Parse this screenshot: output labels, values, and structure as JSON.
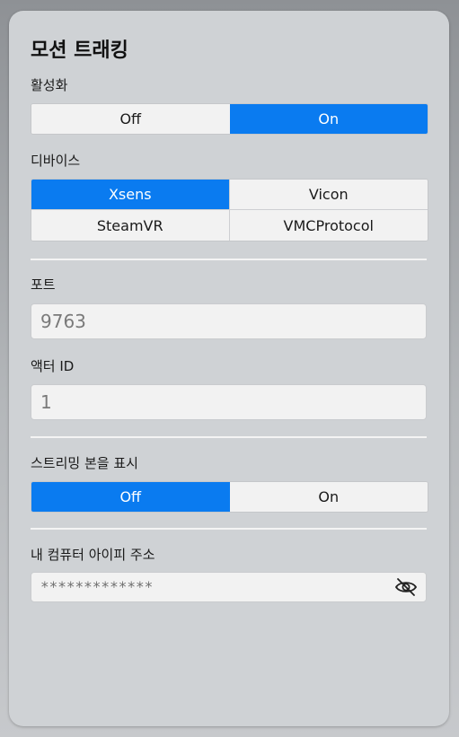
{
  "panel": {
    "title": "모션 트래킹"
  },
  "activation": {
    "label": "활성화",
    "options": [
      "Off",
      "On"
    ],
    "selected": "On"
  },
  "device": {
    "label": "디바이스",
    "options": [
      "Xsens",
      "Vicon",
      "SteamVR",
      "VMCProtocol"
    ],
    "selected": "Xsens"
  },
  "port": {
    "label": "포트",
    "value": "9763"
  },
  "actor_id": {
    "label": "액터 ID",
    "value": "1"
  },
  "show_streaming_bones": {
    "label": "스트리밍 본을 표시",
    "options": [
      "Off",
      "On"
    ],
    "selected": "Off"
  },
  "my_ip": {
    "label": "내 컴퓨터 아이피 주소",
    "masked_value": "*************",
    "reveal_icon": "eye-slash-icon"
  },
  "colors": {
    "accent": "#0a7bf0",
    "panel": "#cfd2d5",
    "control_bg": "#f2f2f2"
  }
}
